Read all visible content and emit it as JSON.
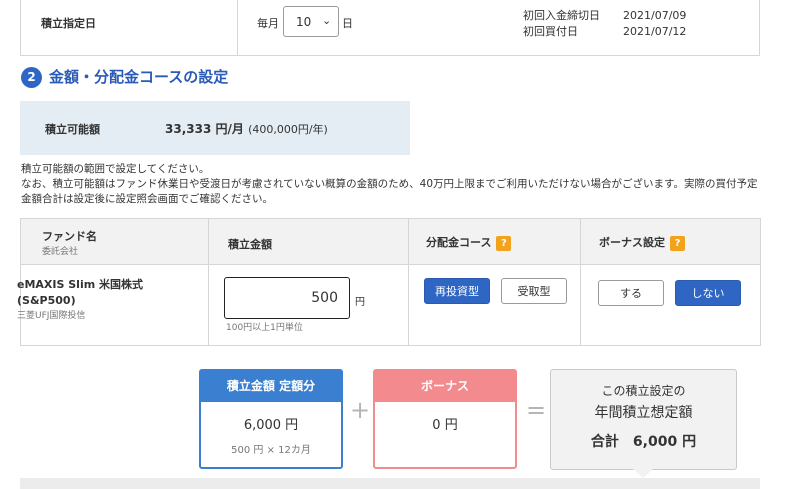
{
  "schedule": {
    "label": "積立指定日",
    "monthly_label": "毎月",
    "day_value": "10",
    "day_suffix": "日",
    "first_deadline_label": "初回入金締切日",
    "first_deadline_value": "2021/07/09",
    "first_purchase_label": "初回買付日",
    "first_purchase_value": "2021/07/12"
  },
  "section": {
    "number": "2",
    "title": "金額・分配金コースの設定"
  },
  "available": {
    "label": "積立可能額",
    "monthly": "33,333 円/月",
    "yearly": "(400,000円/年)"
  },
  "notes": {
    "line1": "積立可能額の範囲で設定してください。",
    "line2": "なお、積立可能額はファンド休業日や受渡日が考慮されていない概算の金額のため、40万円上限までご利用いただけない場合がございます。実際の買付予定金額合計は設定後に設定照会画面でご確認ください。"
  },
  "table": {
    "headers": {
      "fund": "ファンド名",
      "fund_sub": "委託会社",
      "amount": "積立金額",
      "dividend": "分配金コース",
      "bonus": "ボーナス設定",
      "help_glyph": "?"
    },
    "row": {
      "fund_name_line1": "eMAXIS Slim 米国株式",
      "fund_name_line2": "(S&P500)",
      "company": "三菱UFJ国際投信",
      "amount_value": "500",
      "amount_unit": "円",
      "amount_hint": "100円以上1円単位",
      "dividend_options": [
        "再投資型",
        "受取型"
      ],
      "dividend_selected": "再投資型",
      "bonus_options": [
        "する",
        "しない"
      ],
      "bonus_selected": "しない"
    }
  },
  "summary": {
    "fixed": {
      "header": "積立金額 定額分",
      "amount": "6,000 円",
      "detail": "500 円 × 12カ月"
    },
    "plus": "+",
    "bonus": {
      "header": "ボーナス",
      "amount": "0 円"
    },
    "equals": "=",
    "total": {
      "line1": "この積立設定の",
      "line2": "年間積立想定額",
      "line3": "合計　6,000 円"
    }
  },
  "colors": {
    "accent_blue": "#2f66c4",
    "card_blue": "#3a7fd0",
    "card_pink": "#f38a8e",
    "help_orange": "#f3a21b",
    "info_bg": "#e4edf4"
  }
}
